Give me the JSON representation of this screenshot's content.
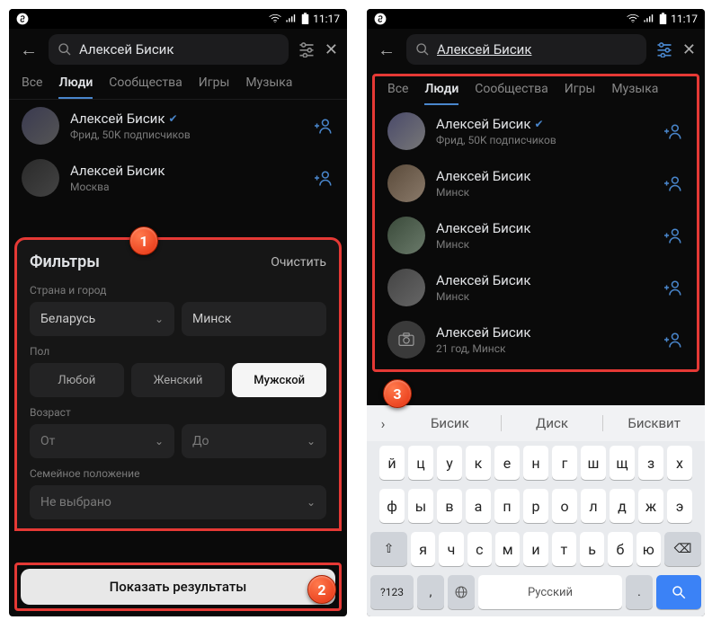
{
  "status": {
    "time": "11:17"
  },
  "search": {
    "query": "Алексей Бисик"
  },
  "tabs": [
    "Все",
    "Люди",
    "Сообщества",
    "Игры",
    "Музыка"
  ],
  "active_tab": "Люди",
  "left": {
    "people": [
      {
        "name": "Алексей Бисик",
        "sub": "Фрид, 50K подписчиков",
        "verified": true
      },
      {
        "name": "Алексей Бисик",
        "sub": "Москва",
        "verified": false
      }
    ],
    "filters": {
      "title": "Фильтры",
      "clear": "Очистить",
      "country_label": "Страна и город",
      "country_value": "Беларусь",
      "city_value": "Минск",
      "gender_label": "Пол",
      "gender_options": [
        "Любой",
        "Женский",
        "Мужской"
      ],
      "gender_selected": "Мужской",
      "age_label": "Возраст",
      "age_from": "От",
      "age_to": "До",
      "marital_label": "Семейное положение",
      "marital_value": "Не выбрано",
      "submit": "Показать результаты"
    }
  },
  "right": {
    "people": [
      {
        "name": "Алексей Бисик",
        "sub": "Фрид, 50K подписчиков",
        "verified": true,
        "avatar": "photo"
      },
      {
        "name": "Алексей Бисик",
        "sub": "Минск",
        "verified": false,
        "avatar": "photo"
      },
      {
        "name": "Алексей Бисик",
        "sub": "Минск",
        "verified": false,
        "avatar": "photo"
      },
      {
        "name": "Алексей Бисик",
        "sub": "Минск",
        "verified": false,
        "avatar": "photo"
      },
      {
        "name": "Алексей Бисик",
        "sub": "21 год, Минск",
        "verified": false,
        "avatar": "camera"
      }
    ],
    "keyboard": {
      "suggestions": [
        "Бисик",
        "Диск",
        "Бисквит"
      ],
      "row1": [
        "й",
        "ц",
        "у",
        "к",
        "е",
        "н",
        "г",
        "ш",
        "щ",
        "з",
        "х"
      ],
      "row2": [
        "ф",
        "ы",
        "в",
        "а",
        "п",
        "р",
        "о",
        "л",
        "д",
        "ж",
        "э"
      ],
      "row3_shift": "⇧",
      "row3": [
        "я",
        "ч",
        "с",
        "м",
        "и",
        "т",
        "ь",
        "б",
        "ю"
      ],
      "row3_back": "⌫",
      "numkey": "?123",
      "lang": "Русский"
    }
  },
  "badges": {
    "b1": "1",
    "b2": "2",
    "b3": "3"
  }
}
